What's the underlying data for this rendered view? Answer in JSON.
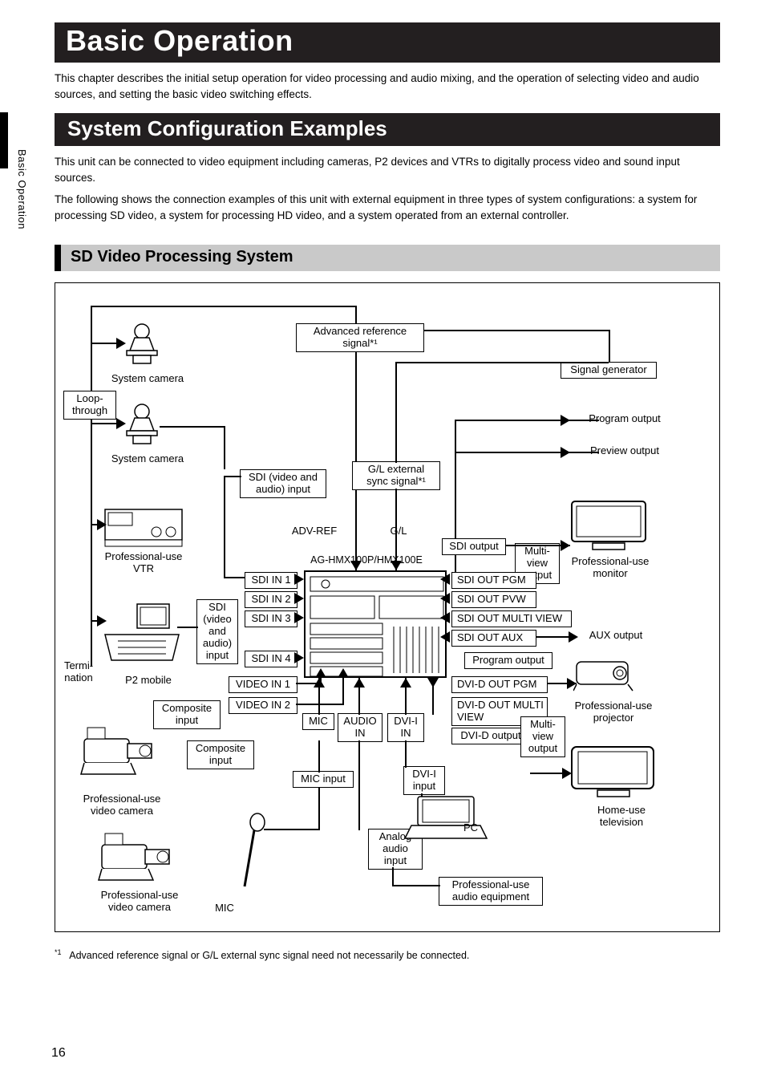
{
  "side_label": "Basic Operation",
  "page_number": "16",
  "h1": "Basic Operation",
  "intro": "This chapter describes the initial setup operation for video processing and audio mixing, and the operation of selecting video and audio sources, and setting the basic video switching effects.",
  "h2": "System Configuration Examples",
  "p1": "This unit can be connected to video equipment including cameras, P2 devices and VTRs to digitally process video and sound input sources.",
  "p2": "The following shows the connection examples of this unit with external equipment in three types of system configurations: a system for processing SD video, a system for processing HD video, and a system operated from an external controller.",
  "h3": "SD Video Processing System",
  "footnote_marker": "*1",
  "footnote_text": "Advanced reference signal or G/L external sync signal need not necessarily be connected.",
  "diagram": {
    "adv_ref_signal": "Advanced reference signal*¹",
    "signal_generator": "Signal generator",
    "system_camera": "System camera",
    "loop_through": "Loop-through",
    "sdi_va_input": "SDI (video and audio) input",
    "gl_ext_sync": "G/L external sync signal*¹",
    "program_output": "Program output",
    "preview_output": "Preview output",
    "adv_ref": "ADV-REF",
    "gl": "G/L",
    "unit_model": "AG-HMX100P/HMX100E",
    "sdi_output": "SDI output",
    "multi_view_output": "Multi-view output",
    "pro_monitor": "Professional-use monitor",
    "pro_vtr": "Professional-use VTR",
    "sdi_in1": "SDI IN 1",
    "sdi_in2": "SDI IN 2",
    "sdi_in3": "SDI IN 3",
    "sdi_in4": "SDI IN 4",
    "video_in1": "VIDEO IN 1",
    "video_in2": "VIDEO IN 2",
    "sdi_out_pgm": "SDI OUT PGM",
    "sdi_out_pvw": "SDI OUT PVW",
    "sdi_out_mv": "SDI OUT MULTI VIEW",
    "sdi_out_aux": "SDI OUT AUX",
    "aux_output": "AUX output",
    "dvid_out_pgm": "DVI-D OUT PGM",
    "dvid_out_mv": "DVI-D OUT MULTI VIEW",
    "dvid_output": "DVI-D output",
    "termination": "Termi-nation",
    "p2_mobile": "P2 mobile",
    "composite_input": "Composite input",
    "pro_video_camera": "Professional-use video camera",
    "mic": "MIC",
    "mic_input": "MIC input",
    "audio_in": "AUDIO IN",
    "dvii_in": "DVI-I IN",
    "dvii_input": "DVI-I input",
    "analog_audio_input": "Analog audio input",
    "pc": "PC",
    "pro_audio": "Professional-use audio equipment",
    "pro_projector": "Professional-use projector",
    "home_tv": "Home-use television"
  }
}
